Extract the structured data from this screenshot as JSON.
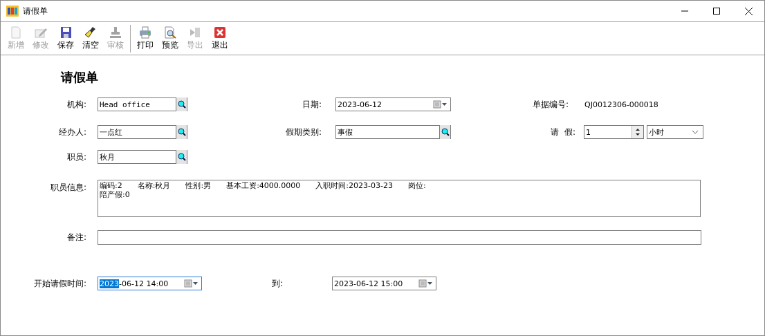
{
  "window": {
    "title": "请假单"
  },
  "toolbar": {
    "groups": [
      [
        {
          "label": "新增",
          "disabled": true
        },
        {
          "label": "修改",
          "disabled": true
        },
        {
          "label": "保存",
          "disabled": false
        },
        {
          "label": "清空",
          "disabled": false
        },
        {
          "label": "审核",
          "disabled": true
        }
      ],
      [
        {
          "label": "打印",
          "disabled": false
        },
        {
          "label": "预览",
          "disabled": false
        },
        {
          "label": "导出",
          "disabled": true
        },
        {
          "label": "退出",
          "disabled": false
        }
      ]
    ]
  },
  "form": {
    "heading": "请假单",
    "organization": {
      "label": "机构:",
      "value": "Head office"
    },
    "date": {
      "label": "日期:",
      "value": "2023-06-12"
    },
    "doc_number": {
      "label": "单据编号:",
      "value": "QJ0012306-000018"
    },
    "handler": {
      "label": "经办人:",
      "value": "一点红"
    },
    "leave_type": {
      "label": "假期类别:",
      "value": "事假"
    },
    "leave_amount": {
      "label": "请  假:",
      "value": "1",
      "unit": "小时"
    },
    "employee": {
      "label": "职员:",
      "value": "秋月"
    },
    "employee_info": {
      "label": "职员信息:",
      "lines": [
        [
          "编码:2",
          "名称:秋月",
          "性别:男",
          "基本工资:4000.0000",
          "入职时间:2023-03-23",
          "岗位:"
        ],
        [
          "陪产假:0"
        ]
      ]
    },
    "remarks": {
      "label": "备注:"
    },
    "start_time": {
      "label": "开始请假时间:",
      "focused": true,
      "value_parts": [
        {
          "text": "2023",
          "selected": true
        },
        {
          "text": "-06-12 14:00",
          "selected": false
        }
      ]
    },
    "end_time": {
      "label": "到:",
      "focused": false,
      "value_parts": [
        {
          "text": "2023-06-12 15:00",
          "selected": false
        }
      ]
    }
  }
}
